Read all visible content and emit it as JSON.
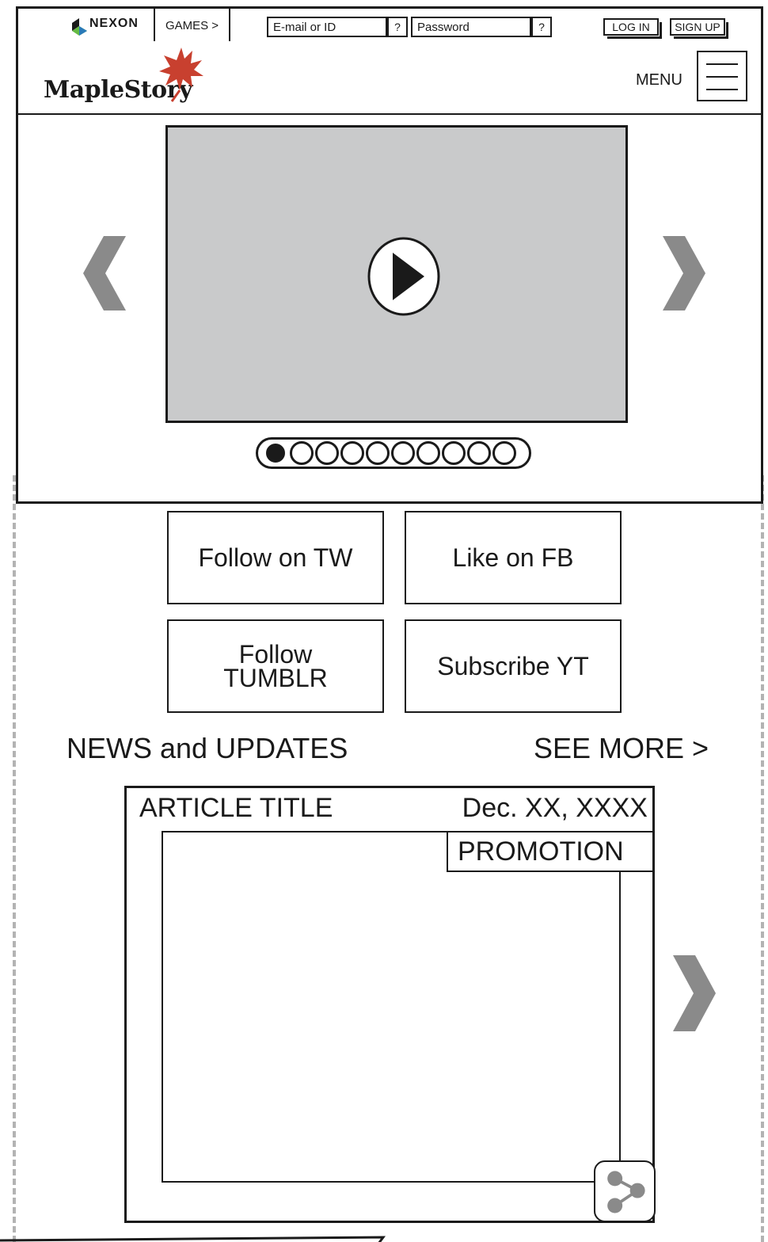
{
  "topbar": {
    "brand": "NEXON",
    "games_label": "GAMES >",
    "email_placeholder": "E-mail or ID",
    "password_placeholder": "Password",
    "help_email": "?",
    "help_password": "?",
    "login_label": "LOG IN",
    "signup_label": "SIGN UP"
  },
  "header": {
    "logo": "MapleStory",
    "menu_label": "MENU"
  },
  "hero": {
    "slide_count": 10,
    "active_slide": 1
  },
  "social": {
    "twitter": "Follow on TW",
    "facebook": "Like on FB",
    "tumblr_line1": "Follow",
    "tumblr_line2": "TUMBLR",
    "youtube": "Subscribe YT"
  },
  "news": {
    "title": "NEWS and UPDATES",
    "see_more": "SEE MORE >",
    "article": {
      "title": "ARTICLE TITLE",
      "date": "Dec. XX, XXXX",
      "category": "PROMOTION"
    }
  },
  "colors": {
    "ink": "#1a1a1a",
    "video_bg": "#c9cacb",
    "arrow_gray": "#8a8a8a",
    "leaf_red": "#c8402f",
    "nexon_green": "#66bb44",
    "nexon_blue": "#2a7ab8"
  }
}
